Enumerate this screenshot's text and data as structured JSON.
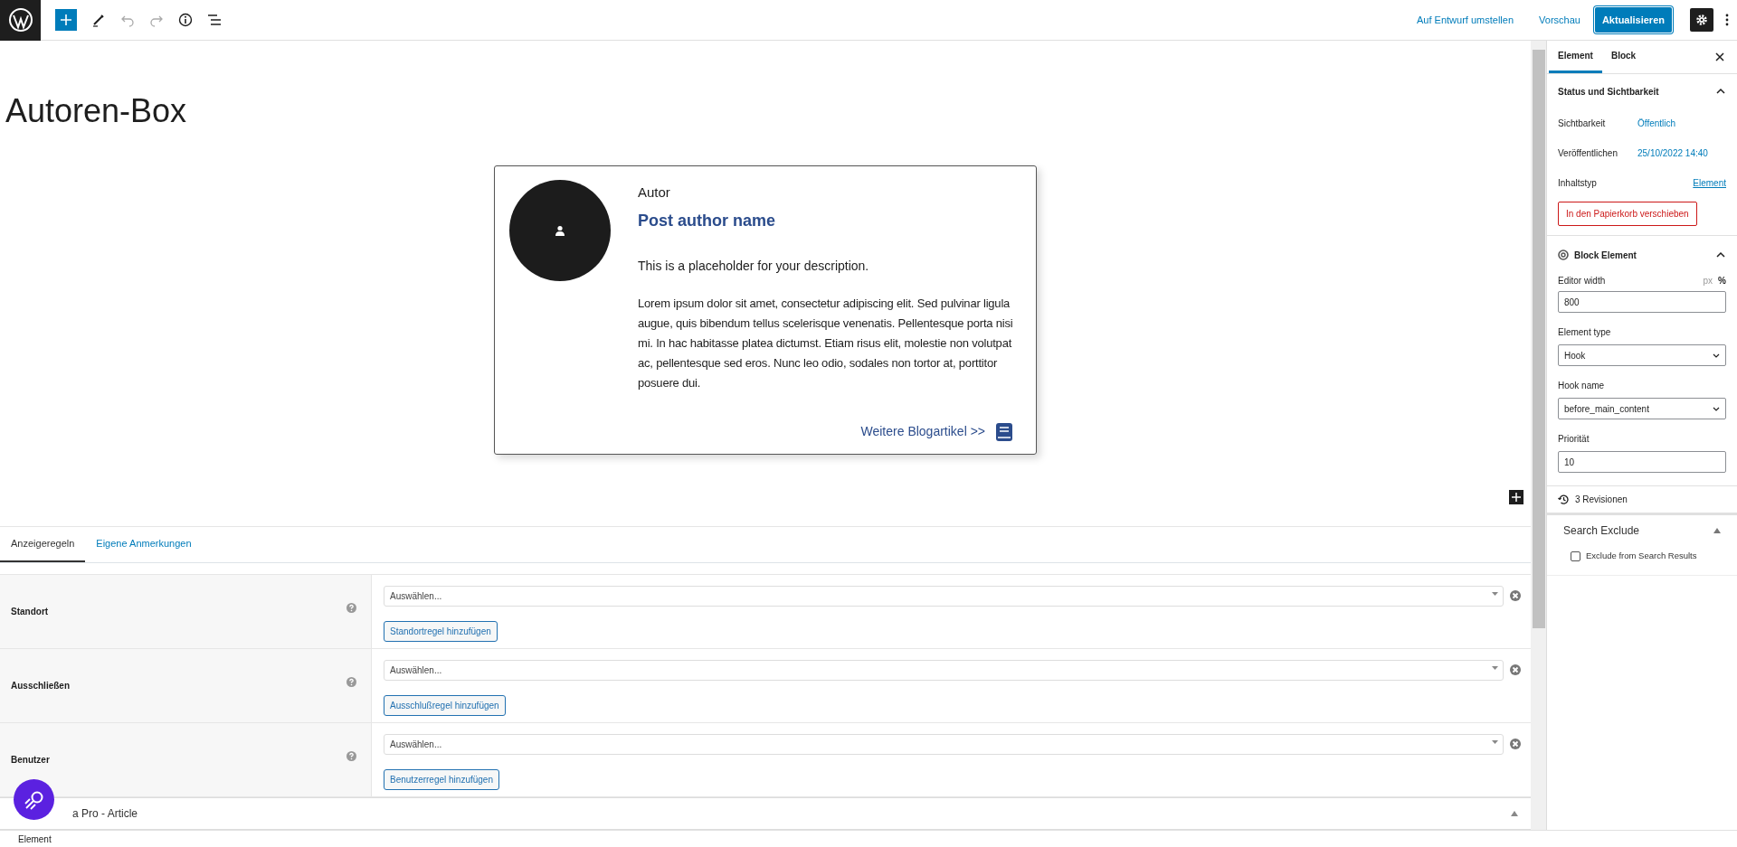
{
  "toolbar": {
    "draft_link": "Auf Entwurf umstellen",
    "preview_link": "Vorschau",
    "update_button": "Aktualisieren"
  },
  "title": "Autoren-Box",
  "author_box": {
    "label": "Autor",
    "name": "Post author name",
    "description": "This is a placeholder for your description.",
    "bio": "Lorem ipsum dolor sit amet, consectetur adipiscing elit. Sed pulvinar ligula augue, quis bibendum tellus scelerisque venenatis. Pellentesque porta nisi mi. In hac habitasse platea dictumst. Etiam risus elit, molestie non volutpat ac, pellentesque sed eros. Nunc leo odio, sodales non tortor at, porttitor posuere dui.",
    "link": "Weitere Blogartikel >>"
  },
  "bottom_tabs": [
    {
      "label": "Anzeigeregeln",
      "selected": true
    },
    {
      "label": "Eigene Anmerkungen",
      "selected": false
    }
  ],
  "rules": [
    {
      "label": "Standort",
      "placeholder": "Auswählen...",
      "button": "Standortregel hinzufügen"
    },
    {
      "label": "Ausschließen",
      "placeholder": "Auswählen...",
      "button": "Ausschlußregel hinzufügen"
    },
    {
      "label": "Benutzer",
      "placeholder": "Auswählen...",
      "button": "Benutzerregel hinzufügen"
    }
  ],
  "collapsed_panel": {
    "title": "a Pro - Article",
    "expanded": false
  },
  "breadcrumb": "Element",
  "sidebar": {
    "tabs": [
      {
        "label": "Element",
        "selected": true
      },
      {
        "label": "Block",
        "selected": false
      }
    ],
    "status": {
      "title": "Status und Sichtbarkeit",
      "expanded": true,
      "rows": [
        {
          "label": "Sichtbarkeit",
          "value": "Öffentlich",
          "kind": "button"
        },
        {
          "label": "Veröffentlichen",
          "value": "25/10/2022 14:40",
          "kind": "button"
        },
        {
          "label": "Inhaltstyp",
          "value": "Element",
          "kind": "link"
        }
      ],
      "trash_button": "In den Papierkorb verschieben"
    },
    "block_element": {
      "title": "Block Element",
      "expanded": true,
      "editor_width": {
        "label": "Editor width",
        "units": [
          {
            "label": "px",
            "selected": false
          },
          {
            "label": "%",
            "selected": true
          }
        ],
        "value": "800"
      },
      "element_type": {
        "label": "Element type",
        "value": "Hook"
      },
      "hook_name": {
        "label": "Hook name",
        "value": "before_main_content"
      },
      "priority": {
        "label": "Priorität",
        "value": "10"
      }
    },
    "revisions": "3 Revisionen",
    "search_exclude": {
      "title": "Search Exclude",
      "expanded": true,
      "checkbox": {
        "label": "Exclude from Search Results",
        "checked": false
      }
    }
  }
}
